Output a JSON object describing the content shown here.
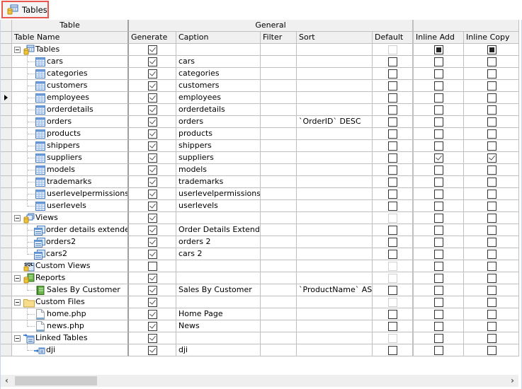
{
  "toolbar": {
    "tables_tab": "Tables",
    "tables_tab_icon": "database-table-icon"
  },
  "header": {
    "group_table": "Table",
    "group_general": "General",
    "columns": {
      "name": "Table Name",
      "generate": "Generate",
      "caption": "Caption",
      "filter": "Filter",
      "sort": "Sort",
      "default": "Default",
      "inline_add": "Inline Add",
      "inline_copy": "Inline Copy"
    }
  },
  "current_row_index": 5,
  "rows": [
    {
      "name": "Tables",
      "level": 0,
      "icon": "tables-group-icon",
      "expander": true,
      "generate": true,
      "caption": "",
      "filter": "",
      "sort": "",
      "default": "disabled",
      "inline_add": "indeterminate",
      "inline_copy": "indeterminate"
    },
    {
      "name": "cars",
      "level": 1,
      "icon": "table-icon",
      "generate": true,
      "caption": "cars",
      "filter": "",
      "sort": "",
      "default": "off",
      "inline_add": "off",
      "inline_copy": "off"
    },
    {
      "name": "categories",
      "level": 1,
      "icon": "table-icon",
      "generate": true,
      "caption": "categories",
      "filter": "",
      "sort": "",
      "default": "off",
      "inline_add": "off",
      "inline_copy": "off"
    },
    {
      "name": "customers",
      "level": 1,
      "icon": "table-icon",
      "generate": true,
      "caption": "customers",
      "filter": "",
      "sort": "",
      "default": "off",
      "inline_add": "off",
      "inline_copy": "off"
    },
    {
      "name": "employees",
      "level": 1,
      "icon": "table-icon",
      "generate": true,
      "caption": "employees",
      "filter": "",
      "sort": "",
      "default": "off",
      "inline_add": "off",
      "inline_copy": "off"
    },
    {
      "name": "orderdetails",
      "level": 1,
      "icon": "table-icon",
      "generate": true,
      "caption": "orderdetails",
      "filter": "",
      "sort": "",
      "default": "off",
      "inline_add": "off",
      "inline_copy": "off"
    },
    {
      "name": "orders",
      "level": 1,
      "icon": "table-icon",
      "generate": true,
      "caption": "orders",
      "filter": "",
      "sort": "`OrderID` DESC",
      "default": "off",
      "inline_add": "off",
      "inline_copy": "off"
    },
    {
      "name": "products",
      "level": 1,
      "icon": "table-icon",
      "generate": true,
      "caption": "products",
      "filter": "",
      "sort": "",
      "default": "off",
      "inline_add": "off",
      "inline_copy": "off"
    },
    {
      "name": "shippers",
      "level": 1,
      "icon": "table-icon",
      "generate": true,
      "caption": "shippers",
      "filter": "",
      "sort": "",
      "default": "off",
      "inline_add": "off",
      "inline_copy": "off"
    },
    {
      "name": "suppliers",
      "level": 1,
      "icon": "table-icon",
      "generate": true,
      "caption": "suppliers",
      "filter": "",
      "sort": "",
      "default": "off",
      "inline_add": "on",
      "inline_copy": "on"
    },
    {
      "name": "models",
      "level": 1,
      "icon": "table-icon",
      "generate": true,
      "caption": "models",
      "filter": "",
      "sort": "",
      "default": "off",
      "inline_add": "off",
      "inline_copy": "off"
    },
    {
      "name": "trademarks",
      "level": 1,
      "icon": "table-icon",
      "generate": true,
      "caption": "trademarks",
      "filter": "",
      "sort": "",
      "default": "off",
      "inline_add": "off",
      "inline_copy": "off"
    },
    {
      "name": "userlevelpermissions",
      "level": 1,
      "icon": "table-icon",
      "generate": true,
      "caption": "userlevelpermissions",
      "filter": "",
      "sort": "",
      "default": "off",
      "inline_add": "off",
      "inline_copy": "off"
    },
    {
      "name": "userlevels",
      "level": 1,
      "icon": "table-icon",
      "generate": true,
      "caption": "userlevels",
      "filter": "",
      "sort": "",
      "default": "off",
      "inline_add": "off",
      "inline_copy": "off"
    },
    {
      "name": "Views",
      "level": 0,
      "icon": "views-group-icon",
      "expander": true,
      "generate": true,
      "caption": "",
      "filter": "",
      "sort": "",
      "default": "disabled",
      "inline_add": "off",
      "inline_copy": "off"
    },
    {
      "name": "order details extended",
      "level": 1,
      "icon": "view-icon",
      "generate": true,
      "caption": "Order Details Extended",
      "filter": "",
      "sort": "",
      "default": "off",
      "inline_add": "off",
      "inline_copy": "off"
    },
    {
      "name": "orders2",
      "level": 1,
      "icon": "view-icon",
      "generate": true,
      "caption": "orders 2",
      "filter": "",
      "sort": "",
      "default": "off",
      "inline_add": "off",
      "inline_copy": "off"
    },
    {
      "name": "cars2",
      "level": 1,
      "icon": "view-icon",
      "generate": true,
      "caption": "cars 2",
      "filter": "",
      "sort": "",
      "default": "off",
      "inline_add": "off",
      "inline_copy": "off"
    },
    {
      "name": "Custom Views",
      "level": 0,
      "icon": "sql-custom-views-icon",
      "expander": false,
      "generate": false,
      "caption": "",
      "filter": "",
      "sort": "",
      "default": "disabled",
      "inline_add": "off",
      "inline_copy": "off"
    },
    {
      "name": "Reports",
      "level": 0,
      "icon": "reports-group-icon",
      "expander": true,
      "generate": true,
      "caption": "",
      "filter": "",
      "sort": "",
      "default": "disabled",
      "inline_add": "off",
      "inline_copy": "off"
    },
    {
      "name": "Sales By Customer",
      "level": 1,
      "icon": "report-icon",
      "generate": true,
      "caption": "Sales By Customer",
      "filter": "",
      "sort": "`ProductName` ASC",
      "default": "off",
      "inline_add": "off",
      "inline_copy": "off"
    },
    {
      "name": "Custom Files",
      "level": 0,
      "icon": "folder-icon",
      "expander": true,
      "generate": true,
      "caption": "",
      "filter": "",
      "sort": "",
      "default": "disabled",
      "inline_add": "off",
      "inline_copy": "off"
    },
    {
      "name": "home.php",
      "level": 1,
      "icon": "file-icon",
      "generate": true,
      "caption": "Home Page",
      "filter": "",
      "sort": "",
      "default": "off",
      "inline_add": "off",
      "inline_copy": "off"
    },
    {
      "name": "news.php",
      "level": 1,
      "icon": "file-icon",
      "generate": true,
      "caption": "News",
      "filter": "",
      "sort": "",
      "default": "off",
      "inline_add": "off",
      "inline_copy": "off"
    },
    {
      "name": "Linked Tables",
      "level": 0,
      "icon": "linked-tables-group-icon",
      "expander": true,
      "generate": true,
      "caption": "",
      "filter": "",
      "sort": "",
      "default": "disabled",
      "inline_add": "off",
      "inline_copy": "off"
    },
    {
      "name": "dji",
      "level": 1,
      "icon": "linked-table-icon",
      "generate": true,
      "caption": "dji",
      "filter": "",
      "sort": "",
      "default": "off",
      "inline_add": "off",
      "inline_copy": "off"
    }
  ]
}
